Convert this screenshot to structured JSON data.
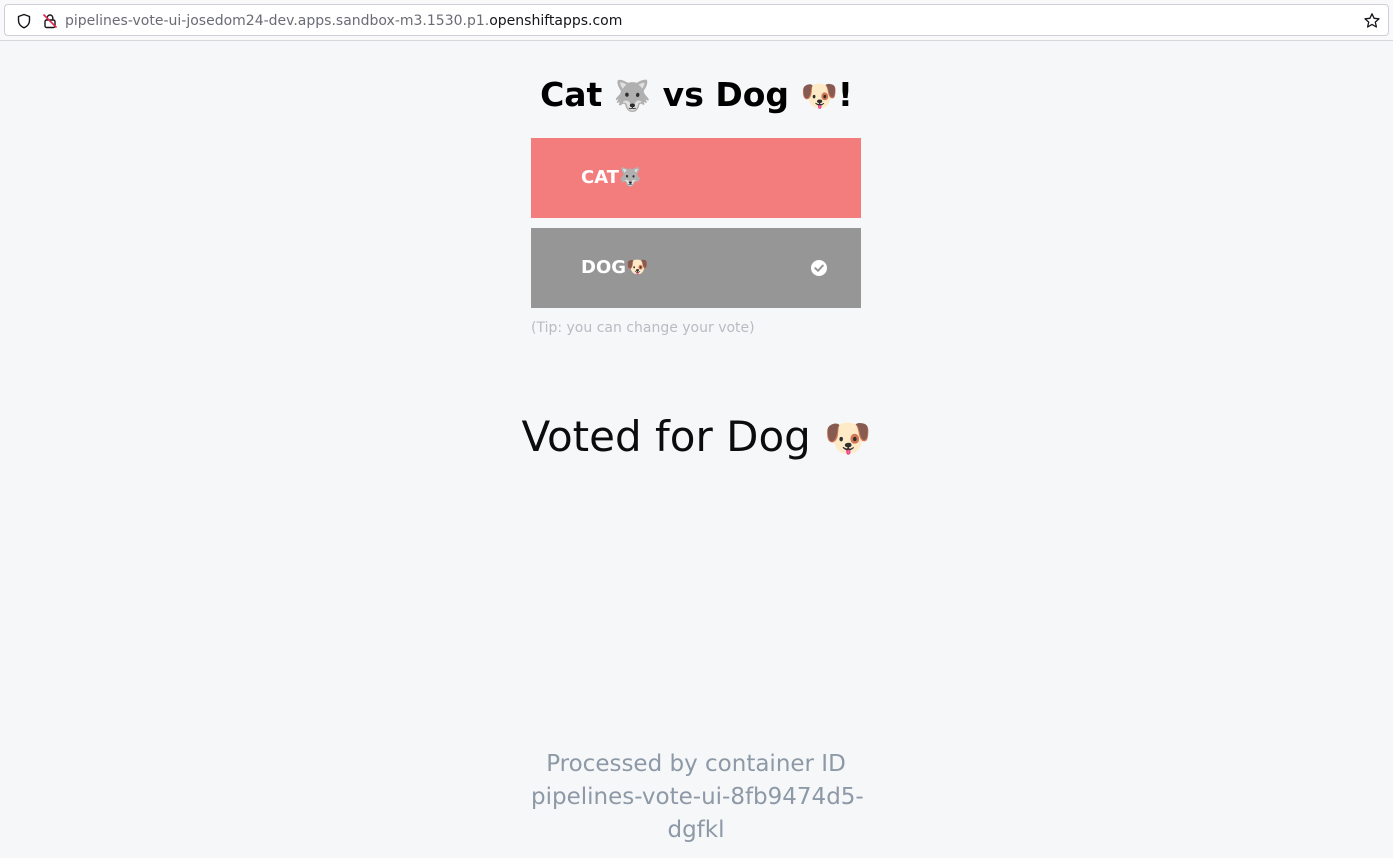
{
  "browser": {
    "url_prefix": "pipelines-vote-ui-josedom24-dev.apps.sandbox-m3.1530.p1.",
    "url_domain": "openshiftapps.com",
    "icons": [
      "shield-icon",
      "insecure-lock-icon",
      "bookmark-star-icon"
    ]
  },
  "page": {
    "title_part1": "Cat ",
    "title_emoji1": "🐺",
    "title_part2": " vs Dog ",
    "title_emoji2": "🐶",
    "title_part3": "!",
    "cat_button": {
      "label": "CAT",
      "emoji": "🐺",
      "color": "#f37d7d",
      "selected": false
    },
    "dog_button": {
      "label": "DOG",
      "emoji": "🐶",
      "color": "#969696",
      "selected": true,
      "icon": "check-circle-icon"
    },
    "tip": "(Tip: you can change your vote)",
    "result_text": "Voted for Dog ",
    "result_emoji": "🐶",
    "footer_line1": "Processed by container ID",
    "footer_line2": "pipelines-vote-ui-8fb9474d5-",
    "footer_line3": "dgfkl"
  }
}
